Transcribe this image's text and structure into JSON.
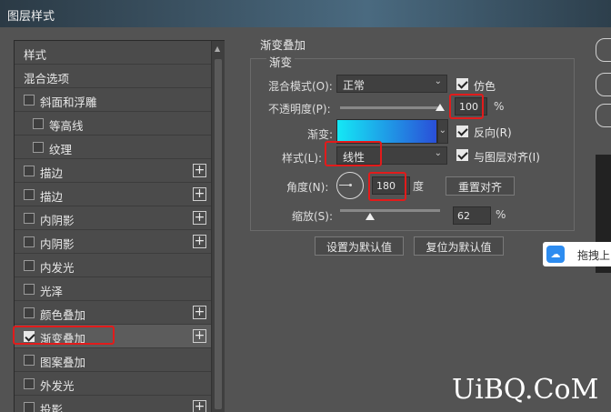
{
  "window": {
    "title": "图层样式"
  },
  "left_panel": {
    "items": [
      {
        "label": "样式",
        "checkbox": false,
        "checked": false,
        "plus": false,
        "selected": false
      },
      {
        "label": "混合选项",
        "checkbox": false,
        "checked": false,
        "plus": false,
        "selected": false
      },
      {
        "label": "斜面和浮雕",
        "checkbox": true,
        "checked": false,
        "plus": false,
        "selected": false
      },
      {
        "label": "等高线",
        "checkbox": true,
        "checked": false,
        "plus": false,
        "selected": false
      },
      {
        "label": "纹理",
        "checkbox": true,
        "checked": false,
        "plus": false,
        "selected": false
      },
      {
        "label": "描边",
        "checkbox": true,
        "checked": false,
        "plus": true,
        "selected": false
      },
      {
        "label": "描边",
        "checkbox": true,
        "checked": false,
        "plus": true,
        "selected": false
      },
      {
        "label": "内阴影",
        "checkbox": true,
        "checked": false,
        "plus": true,
        "selected": false
      },
      {
        "label": "内阴影",
        "checkbox": true,
        "checked": false,
        "plus": true,
        "selected": false
      },
      {
        "label": "内发光",
        "checkbox": true,
        "checked": false,
        "plus": false,
        "selected": false
      },
      {
        "label": "光泽",
        "checkbox": true,
        "checked": false,
        "plus": false,
        "selected": false
      },
      {
        "label": "颜色叠加",
        "checkbox": true,
        "checked": false,
        "plus": true,
        "selected": false
      },
      {
        "label": "渐变叠加",
        "checkbox": true,
        "checked": true,
        "plus": true,
        "selected": true
      },
      {
        "label": "图案叠加",
        "checkbox": true,
        "checked": false,
        "plus": false,
        "selected": false
      },
      {
        "label": "外发光",
        "checkbox": true,
        "checked": false,
        "plus": false,
        "selected": false
      },
      {
        "label": "投影",
        "checkbox": true,
        "checked": false,
        "plus": true,
        "selected": false
      }
    ]
  },
  "gradient_overlay": {
    "section_title": "渐变叠加",
    "group_title": "渐变",
    "blend_mode": {
      "label": "混合模式(O):",
      "value": "正常"
    },
    "dither": {
      "label": "仿色",
      "checked": true
    },
    "opacity": {
      "label": "不透明度(P):",
      "value": "100",
      "unit": "%",
      "level": 1.0
    },
    "gradient": {
      "label": "渐变:",
      "color_start": "#14e8f5",
      "color_end": "#2a4fd8"
    },
    "reverse": {
      "label": "反向(R)",
      "checked": true
    },
    "style": {
      "label": "样式(L):",
      "value": "线性"
    },
    "align_with_layer": {
      "label": "与图层对齐(I)",
      "checked": true
    },
    "angle": {
      "label": "角度(N):",
      "value": "180",
      "unit": "度"
    },
    "reset_align_button": "重置对齐",
    "scale": {
      "label": "缩放(S):",
      "value": "62",
      "unit": "%",
      "level": 0.62
    },
    "set_default_button": "设置为默认值",
    "reset_default_button": "复位为默认值"
  },
  "popup": {
    "text": "拖拽上"
  },
  "watermark": {
    "text": "UiBQ.CoM"
  },
  "colors": {
    "highlight": "#e21b1b",
    "panel": "#535353",
    "accent": "#2d8cf0"
  },
  "icons": [
    "plus-icon",
    "checkbox-icon",
    "chevron-down-icon",
    "angle-dial-icon",
    "cloud-icon"
  ]
}
